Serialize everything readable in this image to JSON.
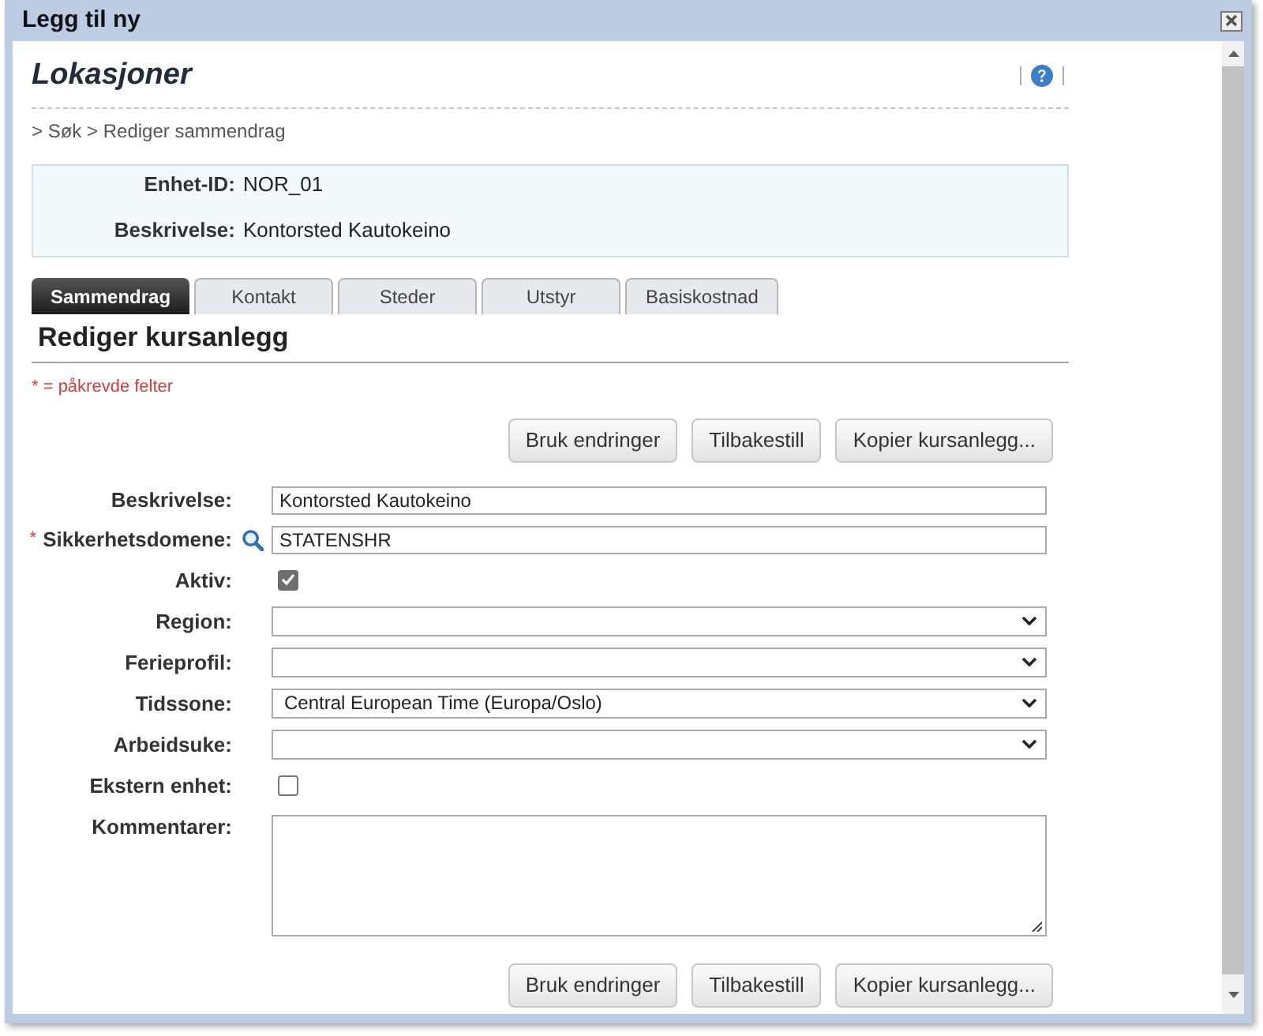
{
  "dialog": {
    "title": "Legg til ny"
  },
  "page": {
    "title": "Lokasjoner",
    "breadcrumb": "> Søk > Rediger sammendrag"
  },
  "summary": [
    {
      "label": "Enhet-ID:",
      "value": "NOR_01"
    },
    {
      "label": "Beskrivelse:",
      "value": "Kontorsted Kautokeino"
    }
  ],
  "tabs": [
    {
      "label": "Sammendrag",
      "selected": true
    },
    {
      "label": "Kontakt",
      "selected": false
    },
    {
      "label": "Steder",
      "selected": false
    },
    {
      "label": "Utstyr",
      "selected": false
    },
    {
      "label": "Basiskostnad",
      "selected": false
    }
  ],
  "section": {
    "title": "Rediger kursanlegg",
    "required_note": "* = påkrevde felter"
  },
  "actions_top": [
    "Bruk endringer",
    "Tilbakestill",
    "Kopier kursanlegg..."
  ],
  "fields": [
    {
      "kind": "text",
      "label": "Beskrivelse:",
      "value": "Kontorsted Kautokeino"
    },
    {
      "kind": "lookup",
      "label": "Sikkerhetsdomene:",
      "required_mark": "*",
      "value": "STATENSHR"
    },
    {
      "kind": "checkbox",
      "label": "Aktiv:",
      "checked": true
    },
    {
      "kind": "select",
      "label": "Region:"
    },
    {
      "kind": "select",
      "label": "Ferieprofil:"
    },
    {
      "kind": "select",
      "label": "Tidssone:",
      "value": "Central European Time (Europa/Oslo)"
    },
    {
      "kind": "select",
      "label": "Arbeidsuke:"
    },
    {
      "kind": "checkbox",
      "label": "Ekstern enhet:",
      "checked": false
    },
    {
      "kind": "textarea",
      "label": "Kommentarer:"
    }
  ],
  "actions_bottom": [
    "Bruk endringer",
    "Tilbakestill",
    "Kopier kursanlegg..."
  ]
}
